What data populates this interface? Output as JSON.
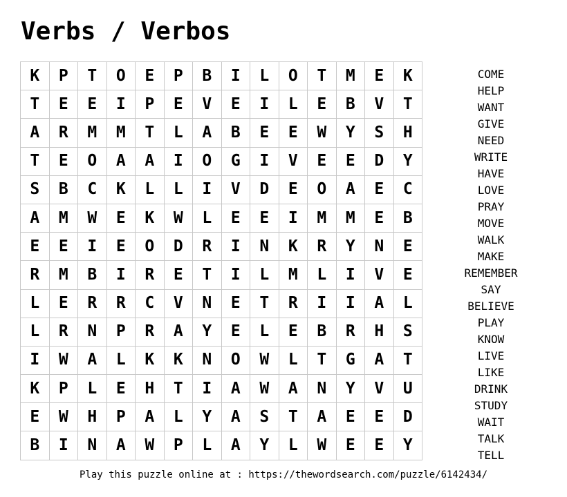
{
  "title": "Verbs / Verbos",
  "grid": [
    [
      "K",
      "P",
      "T",
      "O",
      "E",
      "P",
      "B",
      "I",
      "L",
      "O",
      "T",
      "M",
      "E",
      "K"
    ],
    [
      "T",
      "E",
      "E",
      "I",
      "P",
      "E",
      "V",
      "E",
      "I",
      "L",
      "E",
      "B",
      "V",
      "T"
    ],
    [
      "A",
      "R",
      "M",
      "M",
      "T",
      "L",
      "A",
      "B",
      "E",
      "E",
      "W",
      "Y",
      "S",
      "H"
    ],
    [
      "T",
      "E",
      "O",
      "A",
      "A",
      "I",
      "O",
      "G",
      "I",
      "V",
      "E",
      "E",
      "D",
      "Y"
    ],
    [
      "S",
      "B",
      "C",
      "K",
      "L",
      "L",
      "I",
      "V",
      "D",
      "E",
      "O",
      "A",
      "E",
      "C"
    ],
    [
      "A",
      "M",
      "W",
      "E",
      "K",
      "W",
      "L",
      "E",
      "E",
      "I",
      "M",
      "M",
      "E",
      "B"
    ],
    [
      "E",
      "E",
      "I",
      "E",
      "O",
      "D",
      "R",
      "I",
      "N",
      "K",
      "R",
      "Y",
      "N",
      "E"
    ],
    [
      "R",
      "M",
      "B",
      "I",
      "R",
      "E",
      "T",
      "I",
      "L",
      "M",
      "L",
      "I",
      "V",
      "E"
    ],
    [
      "L",
      "E",
      "R",
      "R",
      "C",
      "V",
      "N",
      "E",
      "T",
      "R",
      "I",
      "I",
      "A",
      "L"
    ],
    [
      "L",
      "R",
      "N",
      "P",
      "R",
      "A",
      "Y",
      "E",
      "L",
      "E",
      "B",
      "R",
      "H",
      "S"
    ],
    [
      "I",
      "W",
      "A",
      "L",
      "K",
      "K",
      "N",
      "O",
      "W",
      "L",
      "T",
      "G",
      "A",
      "T"
    ],
    [
      "K",
      "P",
      "L",
      "E",
      "H",
      "T",
      "I",
      "A",
      "W",
      "A",
      "N",
      "Y",
      "V",
      "U"
    ],
    [
      "E",
      "W",
      "H",
      "P",
      "A",
      "L",
      "Y",
      "A",
      "S",
      "T",
      "A",
      "E",
      "E",
      "D"
    ],
    [
      "B",
      "I",
      "N",
      "A",
      "W",
      "P",
      "L",
      "A",
      "Y",
      "L",
      "W",
      "E",
      "E",
      "Y"
    ]
  ],
  "words": [
    "COME",
    "HELP",
    "WANT",
    "GIVE",
    "NEED",
    "WRITE",
    "HAVE",
    "LOVE",
    "PRAY",
    "MOVE",
    "WALK",
    "MAKE",
    "REMEMBER",
    "SAY",
    "BELIEVE",
    "PLAY",
    "KNOW",
    "LIVE",
    "LIKE",
    "DRINK",
    "STUDY",
    "WAIT",
    "TALK",
    "TELL"
  ],
  "footer": {
    "text": "Play this puzzle online at : https://thewordsearch.com/puzzle/6142434/"
  },
  "colors": {
    "text": "#000000",
    "grid_line": "#c8c8c8",
    "background": "#ffffff"
  }
}
